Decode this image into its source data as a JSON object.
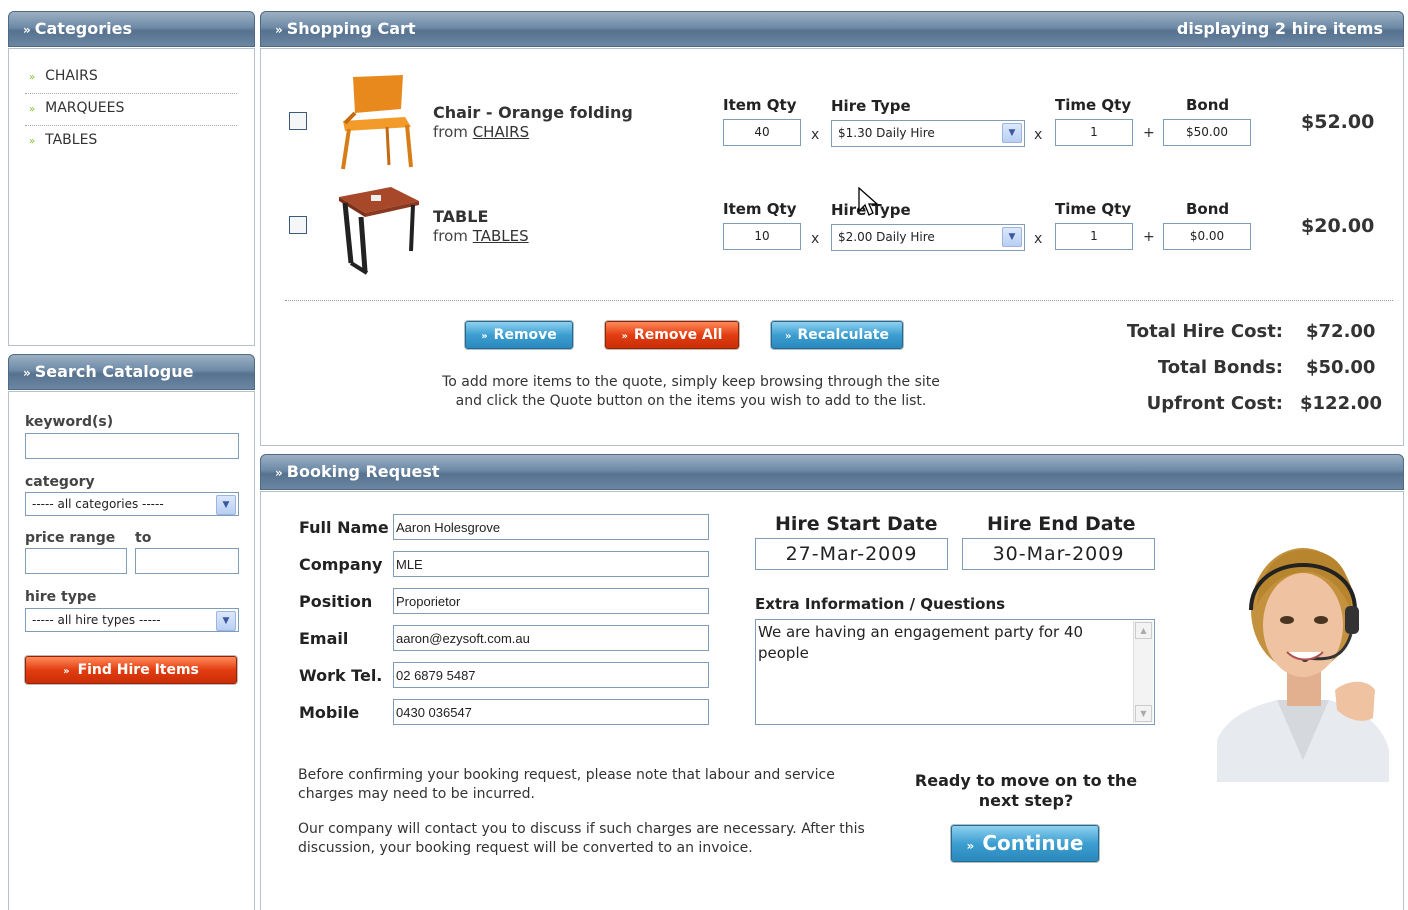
{
  "categories": {
    "title": "Categories",
    "items": [
      {
        "label": "CHAIRS"
      },
      {
        "label": "MARQUEES"
      },
      {
        "label": "TABLES"
      }
    ]
  },
  "search": {
    "title": "Search Catalogue",
    "keyword_label": "keyword(s)",
    "keyword_value": "",
    "category_label": "category",
    "category_value": "----- all categories -----",
    "price_label": "price range",
    "price_to_label": "to",
    "hire_type_label": "hire type",
    "hire_type_value": "----- all hire types -----",
    "find_button": "Find Hire Items"
  },
  "cart": {
    "title": "Shopping Cart",
    "count_text": "displaying 2 hire items",
    "col_item_qty": "Item Qty",
    "col_hire_type": "Hire Type",
    "col_time_qty": "Time Qty",
    "col_bond": "Bond",
    "items": [
      {
        "name": "Chair - Orange folding",
        "from_text": "from",
        "category": "CHAIRS",
        "item_qty": "40",
        "hire_type": "$1.30 Daily Hire",
        "time_qty": "1",
        "bond": "$50.00",
        "total": "$52.00"
      },
      {
        "name": "TABLE",
        "from_text": "from",
        "category": "TABLES",
        "item_qty": "10",
        "hire_type": "$2.00 Daily Hire",
        "time_qty": "1",
        "bond": "$0.00",
        "total": "$20.00"
      }
    ],
    "op_x": "x",
    "op_plus": "+",
    "remove_button": "Remove",
    "remove_all_button": "Remove All",
    "recalculate_button": "Recalculate",
    "help_line1": "To add more items to the quote, simply keep browsing through the site",
    "help_line2": "and click the Quote button on the items you wish to add to the list.",
    "total_hire_label": "Total Hire Cost:",
    "total_hire_value": "$72.00",
    "total_bonds_label": "Total Bonds:",
    "total_bonds_value": "$50.00",
    "upfront_label": "Upfront Cost:",
    "upfront_value": "$122.00"
  },
  "booking": {
    "title": "Booking Request",
    "fields": [
      {
        "label": "Full Name",
        "value": "Aaron Holesgrove"
      },
      {
        "label": "Company",
        "value": "MLE"
      },
      {
        "label": "Position",
        "value": "Proporietor"
      },
      {
        "label": "Email",
        "value": "aaron@ezysoft.com.au"
      },
      {
        "label": "Work Tel.",
        "value": "02 6879 5487"
      },
      {
        "label": "Mobile",
        "value": "0430 036547"
      }
    ],
    "start_label": "Hire Start Date",
    "start_value": "27-Mar-2009",
    "end_label": "Hire End Date",
    "end_value": "30-Mar-2009",
    "extra_label": "Extra Information / Questions",
    "extra_value": "We are having an engagement party for 40 people",
    "note1_line1": "Before confirming your booking request, please note that labour and service",
    "note1_line2": "charges may need to be incurred.",
    "note2_line1": "Our company will contact you to discuss if such charges are necessary. After this",
    "note2_line2": "discussion, your booking request will be converted to an invoice.",
    "ready_line1": "Ready to move on to the",
    "ready_line2": "next step?",
    "continue_button": "Continue"
  },
  "colors": {
    "header": "#6d8aa7",
    "red_button": "#e33d12",
    "blue_button": "#3c9fd0",
    "accent_arrow": "#8bbf2f"
  }
}
